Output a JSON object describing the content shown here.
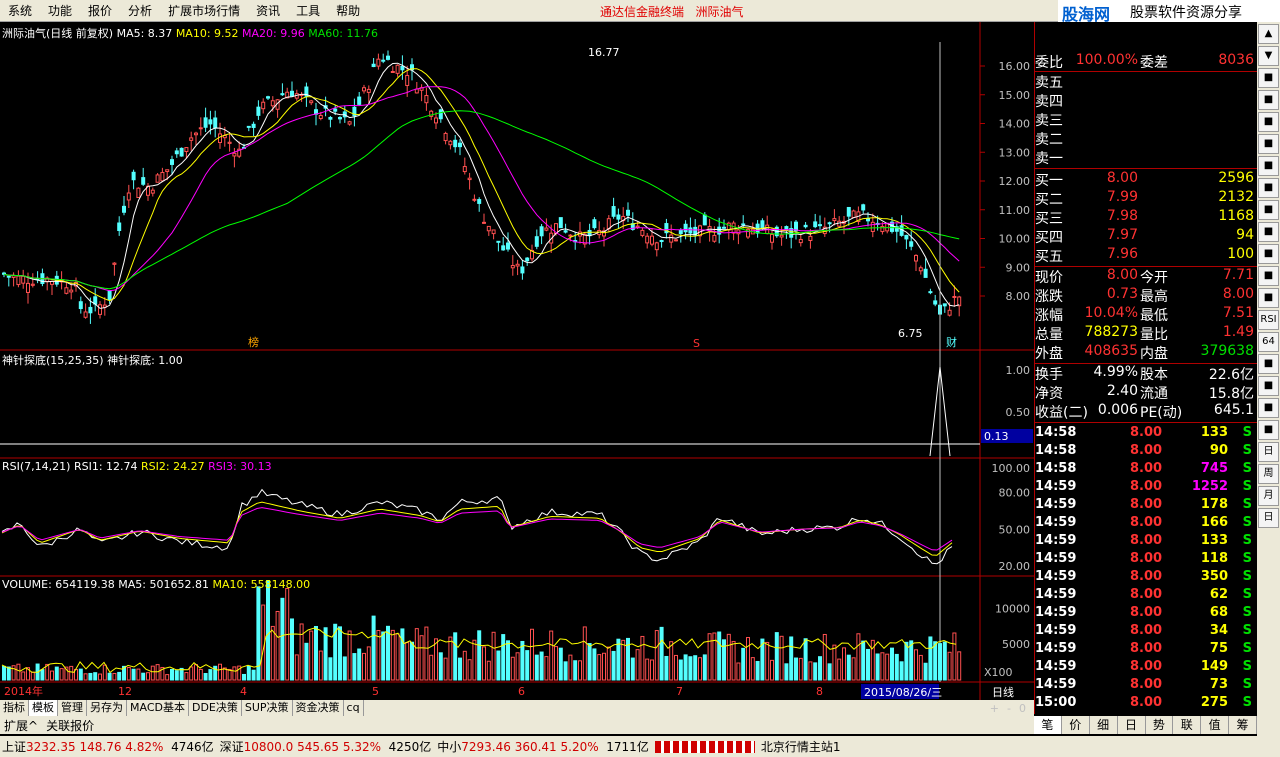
{
  "menu": {
    "items": [
      "系统",
      "功能",
      "报价",
      "分析",
      "扩展市场行情",
      "资讯",
      "工具",
      "帮助"
    ],
    "center_text": "通达信金融终端",
    "stock_name": "洲际油气",
    "logo_text": "股海网",
    "logo_sub": "股票软件资源分享",
    "logo_url": "www.Guhai.com.cn"
  },
  "main_chart": {
    "title": "洲际油气(日线 前复权)",
    "ma5": "MA5: 8.37",
    "ma10": "MA10: 9.52",
    "ma20": "MA20: 9.96",
    "ma60": "MA60: 11.76",
    "high_label": "16.77",
    "low_label": "6.75",
    "y_ticks": [
      "16.00",
      "15.00",
      "14.00",
      "13.00",
      "12.00",
      "11.00",
      "10.00",
      "9.00",
      "8.00"
    ],
    "marker_left": "榜",
    "marker_mid": "S",
    "marker_right": "财"
  },
  "indicator1": {
    "title": "神针探底(15,25,35)",
    "value": "神针探底: 1.00",
    "y_ticks": [
      "1.00",
      "0.50"
    ],
    "box_value": "0.13"
  },
  "rsi": {
    "title": "RSI(7,14,21)",
    "rsi1": "RSI1: 12.74",
    "rsi2": "RSI2: 24.27",
    "rsi3": "RSI3: 30.13",
    "y_ticks": [
      "100.00",
      "80.00",
      "50.00",
      "20.00"
    ]
  },
  "volume": {
    "title": "VOLUME: 654119.38",
    "ma5": "MA5: 501652.81",
    "ma10": "MA10: 558148.00",
    "y_ticks": [
      "10000",
      "5000"
    ],
    "unit": "X100"
  },
  "x_axis": {
    "labels": [
      "2014年",
      "12",
      "4",
      "5",
      "6",
      "7",
      "8"
    ],
    "date_box": "2015/08/26/三",
    "period": "日线"
  },
  "quote": {
    "top_row": {
      "label": "委比",
      "value": "100.00%",
      "label2": "委差",
      "value2": "8036"
    },
    "sells": [
      {
        "label": "卖五",
        "price": "",
        "vol": ""
      },
      {
        "label": "卖四",
        "price": "",
        "vol": ""
      },
      {
        "label": "卖三",
        "price": "",
        "vol": ""
      },
      {
        "label": "卖二",
        "price": "",
        "vol": ""
      },
      {
        "label": "卖一",
        "price": "",
        "vol": ""
      }
    ],
    "buys": [
      {
        "label": "买一",
        "price": "8.00",
        "vol": "2596"
      },
      {
        "label": "买二",
        "price": "7.99",
        "vol": "2132"
      },
      {
        "label": "买三",
        "price": "7.98",
        "vol": "1168"
      },
      {
        "label": "买四",
        "price": "7.97",
        "vol": "94"
      },
      {
        "label": "买五",
        "price": "7.96",
        "vol": "100"
      }
    ],
    "stats": [
      {
        "l1": "现价",
        "v1": "8.00",
        "l2": "今开",
        "v2": "7.71"
      },
      {
        "l1": "涨跌",
        "v1": "0.73",
        "l2": "最高",
        "v2": "8.00"
      },
      {
        "l1": "涨幅",
        "v1": "10.04%",
        "l2": "最低",
        "v2": "7.51"
      },
      {
        "l1": "总量",
        "v1": "788273",
        "l2": "量比",
        "v2": "1.49"
      },
      {
        "l1": "外盘",
        "v1": "408635",
        "l2": "内盘",
        "v2": "379638"
      }
    ],
    "fund": [
      {
        "l1": "换手",
        "v1": "4.99%",
        "l2": "股本",
        "v2": "22.6亿"
      },
      {
        "l1": "净资",
        "v1": "2.40",
        "l2": "流通",
        "v2": "15.8亿"
      },
      {
        "l1": "收益(二)",
        "v1": "0.006",
        "l2": "PE(动)",
        "v2": "645.1"
      }
    ]
  },
  "ticks": [
    {
      "time": "14:58",
      "price": "8.00",
      "vol": "133",
      "bs": "S"
    },
    {
      "time": "14:58",
      "price": "8.00",
      "vol": "90",
      "bs": "S"
    },
    {
      "time": "14:58",
      "price": "8.00",
      "vol": "745",
      "bs": "S"
    },
    {
      "time": "14:59",
      "price": "8.00",
      "vol": "1252",
      "bs": "S"
    },
    {
      "time": "14:59",
      "price": "8.00",
      "vol": "178",
      "bs": "S"
    },
    {
      "time": "14:59",
      "price": "8.00",
      "vol": "166",
      "bs": "S"
    },
    {
      "time": "14:59",
      "price": "8.00",
      "vol": "133",
      "bs": "S"
    },
    {
      "time": "14:59",
      "price": "8.00",
      "vol": "118",
      "bs": "S"
    },
    {
      "time": "14:59",
      "price": "8.00",
      "vol": "350",
      "bs": "S"
    },
    {
      "time": "14:59",
      "price": "8.00",
      "vol": "62",
      "bs": "S"
    },
    {
      "time": "14:59",
      "price": "8.00",
      "vol": "68",
      "bs": "S"
    },
    {
      "time": "14:59",
      "price": "8.00",
      "vol": "34",
      "bs": "S"
    },
    {
      "time": "14:59",
      "price": "8.00",
      "vol": "75",
      "bs": "S"
    },
    {
      "time": "14:59",
      "price": "8.00",
      "vol": "149",
      "bs": "S"
    },
    {
      "time": "14:59",
      "price": "8.00",
      "vol": "73",
      "bs": "S"
    },
    {
      "time": "15:00",
      "price": "8.00",
      "vol": "275",
      "bs": "S"
    }
  ],
  "tabs": [
    "指标",
    "模板",
    "管理",
    "另存为",
    "MACD基本",
    "DDE决策",
    "SUP决策",
    "资金决策",
    "cq"
  ],
  "tabs2": [
    "扩展^",
    "关联报价"
  ],
  "tab_controls": [
    "+",
    "-",
    "0"
  ],
  "right_tabs": [
    "笔",
    "价",
    "细",
    "日",
    "势",
    "联",
    "值",
    "筹"
  ],
  "sidebar_items": [
    "▲",
    "▼",
    "■",
    "■",
    "■",
    "■",
    "■",
    "■",
    "■",
    "■",
    "■",
    "■",
    "■",
    "RSI",
    "64",
    "■",
    "■",
    "■",
    "■",
    "日",
    "周",
    "月",
    "日"
  ],
  "status": {
    "sh_label": "上证",
    "sh_val": "3232.35",
    "sh_chg": "148.76",
    "sh_pct": "4.82%",
    "sh_amt": "4746亿",
    "sz_label": "深证",
    "sz_val": "10800.0",
    "sz_chg": "545.65",
    "sz_pct": "5.32%",
    "sz_amt": "4250亿",
    "zx_label": "中小",
    "zx_val": "7293.46",
    "zx_chg": "360.41",
    "zx_pct": "5.20%",
    "zx_amt": "1711亿",
    "server": "北京行情主站1"
  }
}
